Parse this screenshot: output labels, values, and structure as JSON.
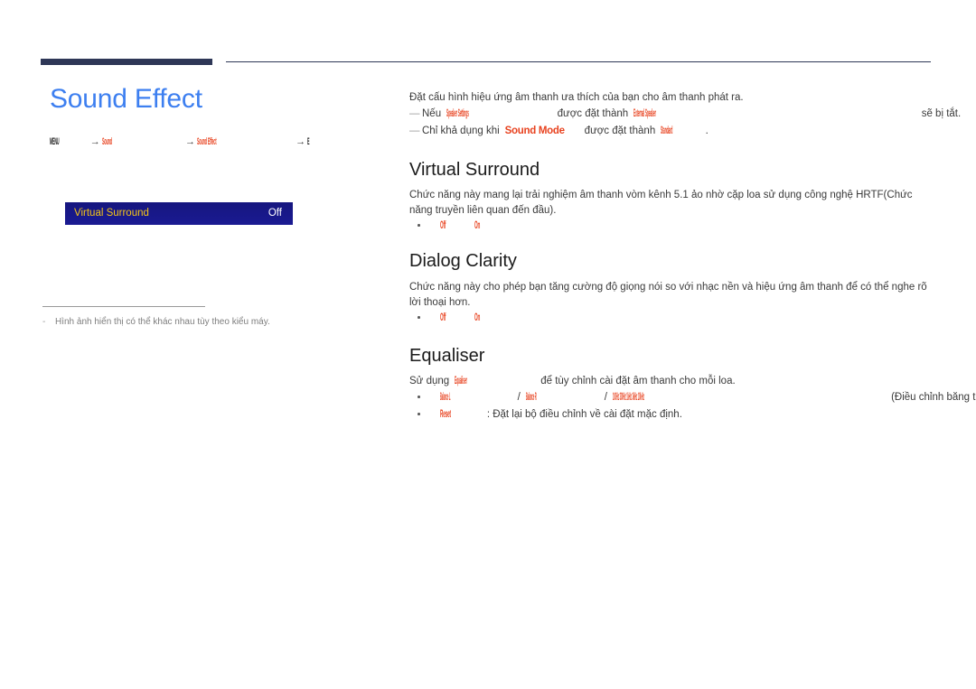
{
  "header": {
    "rule_color": "#2e3757"
  },
  "left": {
    "page_title": "Sound Effect",
    "title_color": "#3d7ff0",
    "breadcrumb": {
      "menu": "MENU",
      "arrow": "→",
      "sound": "Sound",
      "sound_effect": "Sound Effect",
      "enter": "E"
    },
    "osd": {
      "label": "Virtual Surround",
      "value": "Off",
      "label_color": "#f5c518",
      "background_color": "#1a1a8c"
    },
    "footnote": {
      "dash": "-",
      "text": "Hình ảnh hiển thị có thể khác nhau tùy theo kiểu máy."
    }
  },
  "right": {
    "intro": "Đặt cấu hình hiệu ứng âm thanh ưa thích của bạn cho âm thanh phát ra.",
    "notes": [
      {
        "dash": "—",
        "prefix": "Nếu",
        "kw1": "Speaker Settings",
        "middle": "được đặt thành",
        "kw2": "External Speaker",
        "suffix": "sẽ bị tắt."
      },
      {
        "dash": "—",
        "prefix": "Chỉ khả dụng khi",
        "kw1": "Sound Mode",
        "middle": "được đặt thành",
        "kw2": "Standard",
        "suffix": "."
      }
    ],
    "sections": [
      {
        "heading": "Virtual Surround",
        "body": "Chức năng này mang lại trải nghiệm âm thanh vòm kênh 5.1 ảo nhờ cặp loa sử dụng công nghệ HRTF(Chức năng truyền liên quan đến đầu).",
        "options": [
          "Off",
          "On"
        ],
        "separator": "/"
      },
      {
        "heading": "Dialog Clarity",
        "body": "Chức năng này cho phép bạn tăng cường độ giọng nói so với nhạc nền và hiệu ứng âm thanh để có thể nghe rõ lời thoại hơn.",
        "options": [
          "Off",
          "On"
        ],
        "separator": "/"
      },
      {
        "heading": "Equaliser",
        "body_prefix": "Sử dụng",
        "body_kw": "Equaliser",
        "body_suffix": "để tùy chỉnh cài đặt âm thanh cho mỗi loa.",
        "bullets": [
          {
            "kw1": "Balance L",
            "sep1": "/",
            "kw2": "Balance R",
            "sep2": "/",
            "kw3": "100Hz 300Hz 1kHz 3kHz 10kHz",
            "text": "(Điều chỉnh băng thông): Điều chỉnh mức tần số băng thông cụ thể."
          },
          {
            "kw1": "Reset",
            "text": ": Đặt lại bộ điều chỉnh về cài đặt mặc định."
          }
        ]
      }
    ]
  }
}
